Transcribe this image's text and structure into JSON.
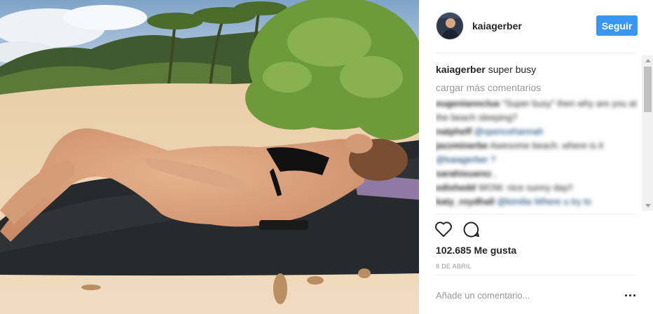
{
  "post": {
    "username": "kaiagerber",
    "follow_label": "Seguir",
    "caption_user": "kaiagerber",
    "caption_text": " super busy",
    "load_more": "cargar más comentarios",
    "likes": "102.685 Me gusta",
    "date": "8 DE ABRIL",
    "add_comment_placeholder": "Añade un comentario..."
  },
  "comments": [
    {
      "user": "eugeniannclua",
      "text": " \"Super busy\" then why are you at the beach sleeping?",
      "mention": ""
    },
    {
      "user": "natpheff",
      "text": " ",
      "mention": "@spencehannah"
    },
    {
      "user": "jazzminerbe",
      "text": " Awesome beach. where is it ",
      "mention": "@kaiagerber ?"
    },
    {
      "user": "sarahisuarez",
      "text": " ,  ",
      "mention": ""
    },
    {
      "user": "edishedd",
      "text": " WOW. nice sunny day!!",
      "mention": ""
    },
    {
      "user": "katy_roydhall",
      "text": " ",
      "mention": "@kimilia Where u try to"
    }
  ],
  "icons": {
    "like": "heart-icon",
    "comment": "comment-icon",
    "more": "more-options-icon"
  },
  "colors": {
    "accent": "#3897f0",
    "muted_text": "#999999",
    "divider": "#efefef"
  }
}
